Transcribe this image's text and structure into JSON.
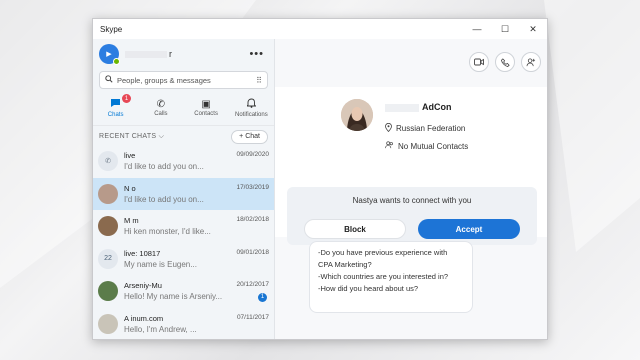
{
  "window": {
    "title": "Skype",
    "minimize": "—",
    "maximize": "☐",
    "close": "✕"
  },
  "profile": {
    "name_suffix": "r",
    "more": "•••",
    "avatar_glyph": "▶"
  },
  "search": {
    "placeholder": "People, groups & messages",
    "icon": "search-icon",
    "dialpad": "⠿"
  },
  "nav": {
    "tabs": [
      {
        "label": "Chats",
        "icon": "chat-icon",
        "glyph": "💬",
        "badge": "1",
        "active": true
      },
      {
        "label": "Calls",
        "icon": "phone-icon",
        "glyph": "✆"
      },
      {
        "label": "Contacts",
        "icon": "contacts-icon",
        "glyph": "▣"
      },
      {
        "label": "Notifications",
        "icon": "bell-icon",
        "glyph": "🔔"
      }
    ]
  },
  "recent": {
    "label": "RECENT CHATS ⌵",
    "new_chat": "+ Chat"
  },
  "chats": [
    {
      "name": "live",
      "date": "09/09/2020",
      "message": "I'd like to add you on...",
      "avatar": "✆",
      "avatar_bg": "#e3e8ee",
      "avatar_fg": "#6f7c8a"
    },
    {
      "name": "N          o",
      "date": "17/03/2019",
      "message": "I'd like to add you on...",
      "avatar": "",
      "avatar_bg": "#b79a8a",
      "avatar_fg": "#ffffff",
      "selected": true
    },
    {
      "name": "M              m",
      "date": "18/02/2018",
      "message": "Hi ken monster, I'd like...",
      "avatar": "",
      "avatar_bg": "#8a6a4e",
      "avatar_fg": "#ffffff"
    },
    {
      "name": "live:          10817",
      "date": "09/01/2018",
      "message": "My name is Eugen...",
      "avatar": "22",
      "avatar_bg": "#e3e8ee",
      "avatar_fg": "#4a6075"
    },
    {
      "name": "Arseniy-Mu",
      "date": "20/12/2017",
      "message": "Hello! My name is Arseniy...",
      "avatar": "",
      "avatar_bg": "#5b7c4a",
      "avatar_fg": "#ffffff",
      "unread": "1"
    },
    {
      "name": "A              inum.com",
      "date": "07/11/2017",
      "message": "Hello, I'm Andrew, ...",
      "avatar": "",
      "avatar_bg": "#c9c4b8",
      "avatar_fg": "#ffffff"
    }
  ],
  "header": {
    "video_icon": "video-call-icon",
    "call_icon": "phone-icon",
    "add_icon": "add-person-icon"
  },
  "contact": {
    "name_suffix": "AdCon",
    "location": "Russian Federation",
    "mutual": "No Mutual Contacts"
  },
  "request": {
    "text": "Nastya wants to connect with you",
    "block": "Block",
    "accept": "Accept"
  },
  "message": {
    "lines": [
      "-Do you have previous experience with",
      "CPA Marketing?",
      "-Which countries are you interested in?",
      "-How did you heard about us?"
    ]
  }
}
